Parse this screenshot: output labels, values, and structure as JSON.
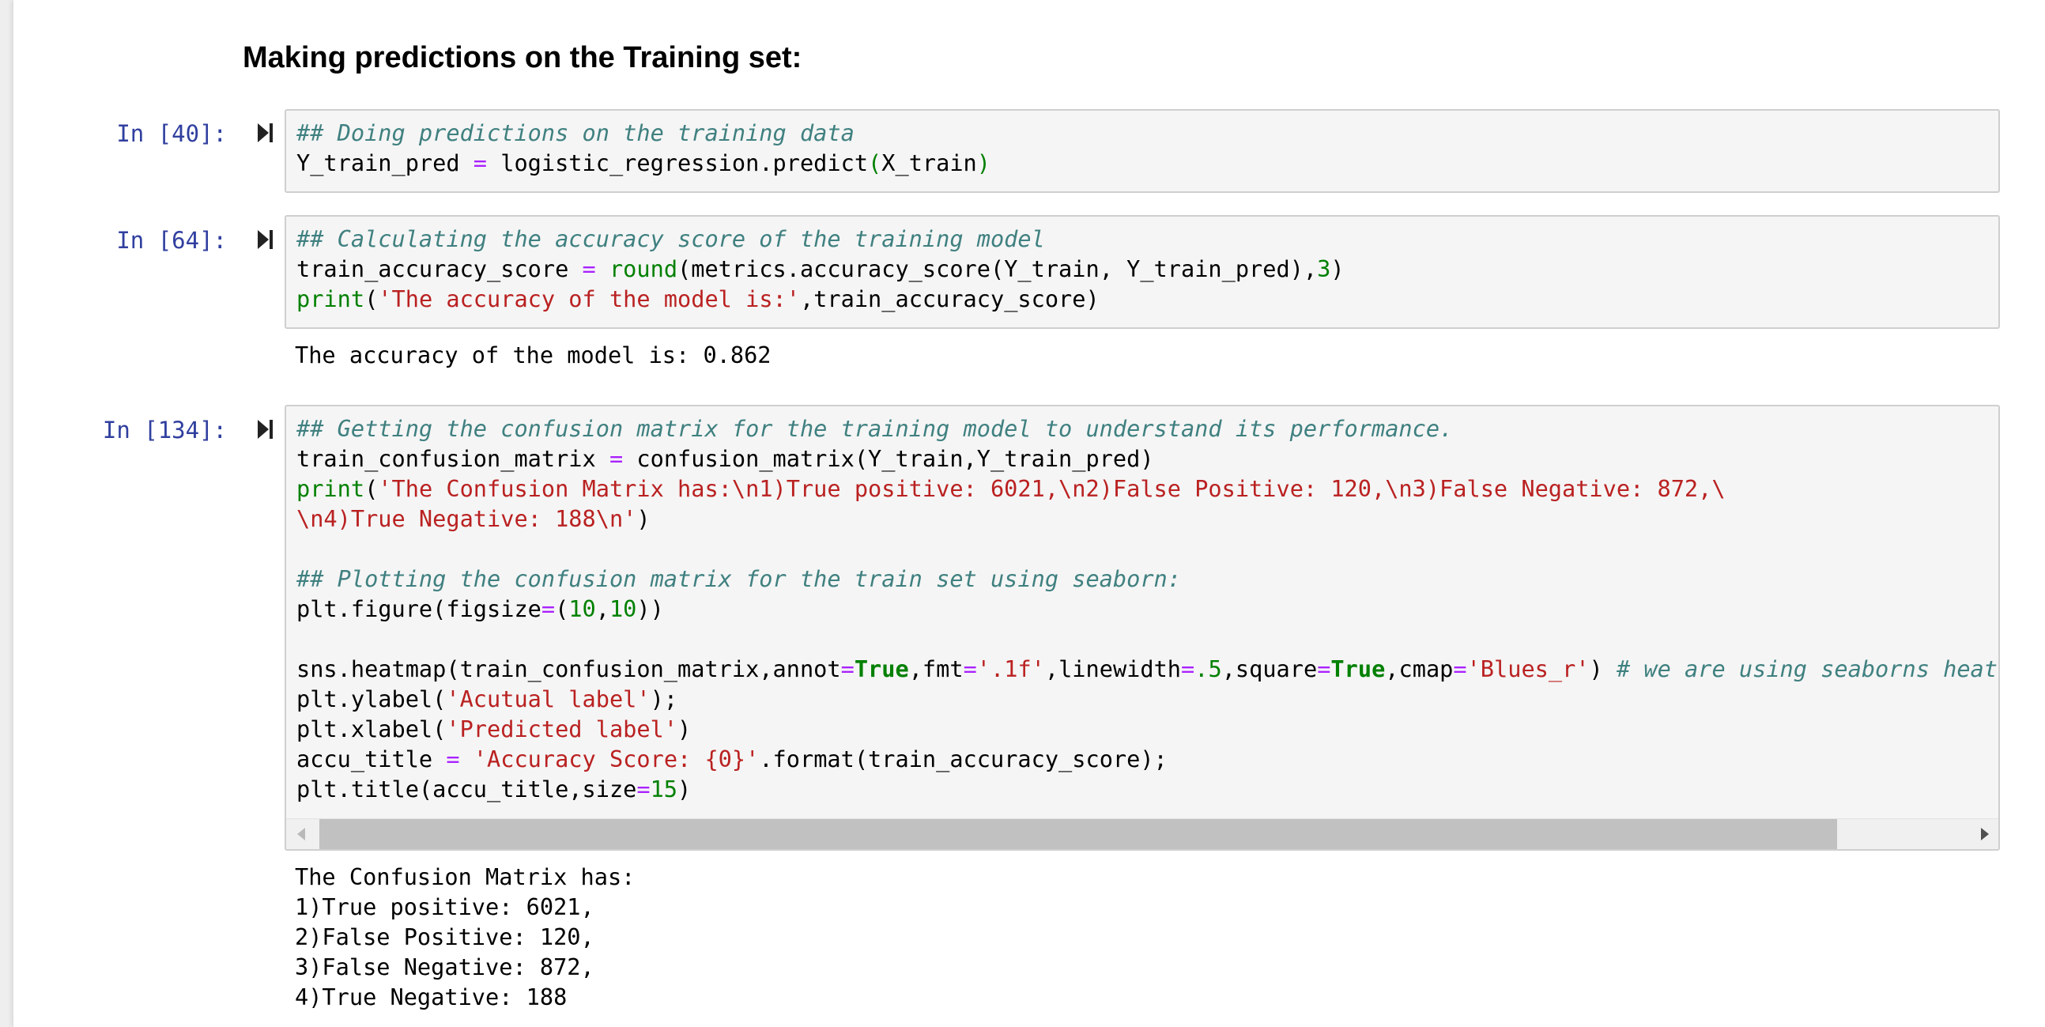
{
  "heading": "Making predictions on the Training set:",
  "icons": {
    "run": "run-cell-icon",
    "scroll_left": "arrow-left-icon",
    "scroll_right": "arrow-right-icon"
  },
  "colors": {
    "prompt": "#303f9f",
    "comment": "#408080",
    "operator": "#aa22ff",
    "number": "#008000",
    "string": "#ba2121",
    "builtin": "#008000",
    "keyword": "#008000"
  },
  "cells": [
    {
      "prompt": "In [40]:",
      "code": [
        [
          {
            "t": "## Doing predictions on the training data",
            "c": "c"
          }
        ],
        [
          {
            "t": "Y_train_pred ",
            "c": "p"
          },
          {
            "t": "=",
            "c": "o"
          },
          {
            "t": " logistic_regression.predict",
            "c": "p"
          },
          {
            "t": "(",
            "c": "pg"
          },
          {
            "t": "X_train",
            "c": "p"
          },
          {
            "t": ")",
            "c": "pg"
          }
        ]
      ],
      "output": null
    },
    {
      "prompt": "In [64]:",
      "code": [
        [
          {
            "t": "## Calculating the accuracy score of the training model",
            "c": "c"
          }
        ],
        [
          {
            "t": "train_accuracy_score ",
            "c": "p"
          },
          {
            "t": "=",
            "c": "o"
          },
          {
            "t": " ",
            "c": "p"
          },
          {
            "t": "round",
            "c": "b"
          },
          {
            "t": "(metrics.accuracy_score(Y_train, Y_train_pred),",
            "c": "p"
          },
          {
            "t": "3",
            "c": "n"
          },
          {
            "t": ")",
            "c": "p"
          }
        ],
        [
          {
            "t": "print",
            "c": "b"
          },
          {
            "t": "(",
            "c": "p"
          },
          {
            "t": "'The accuracy of the model is:'",
            "c": "s"
          },
          {
            "t": ",train_accuracy_score)",
            "c": "p"
          }
        ]
      ],
      "output": [
        "The accuracy of the model is: 0.862"
      ]
    },
    {
      "prompt": "In [134]:",
      "code": [
        [
          {
            "t": "## Getting the confusion matrix for the training model to understand its performance.",
            "c": "c"
          }
        ],
        [
          {
            "t": "train_confusion_matrix ",
            "c": "p"
          },
          {
            "t": "=",
            "c": "o"
          },
          {
            "t": " confusion_matrix(Y_train,Y_train_pred)",
            "c": "p"
          }
        ],
        [
          {
            "t": "print",
            "c": "b"
          },
          {
            "t": "(",
            "c": "p"
          },
          {
            "t": "'The Confusion Matrix has:\\n1)True positive: 6021,\\n2)False Positive: 120,\\n3)False Negative: 872,\\",
            "c": "s"
          }
        ],
        [
          {
            "t": "\\n4)True Negative: 188\\n'",
            "c": "s"
          },
          {
            "t": ")",
            "c": "p"
          }
        ],
        [],
        [
          {
            "t": "## Plotting the confusion matrix for the train set using seaborn:",
            "c": "c"
          }
        ],
        [
          {
            "t": "plt.figure(figsize",
            "c": "p"
          },
          {
            "t": "=",
            "c": "o"
          },
          {
            "t": "(",
            "c": "p"
          },
          {
            "t": "10",
            "c": "n"
          },
          {
            "t": ",",
            "c": "p"
          },
          {
            "t": "10",
            "c": "n"
          },
          {
            "t": "))",
            "c": "p"
          }
        ],
        [],
        [
          {
            "t": "sns.heatmap(train_confusion_matrix,annot",
            "c": "p"
          },
          {
            "t": "=",
            "c": "o"
          },
          {
            "t": "True",
            "c": "k"
          },
          {
            "t": ",fmt",
            "c": "p"
          },
          {
            "t": "=",
            "c": "o"
          },
          {
            "t": "'.1f'",
            "c": "s"
          },
          {
            "t": ",linewidth",
            "c": "p"
          },
          {
            "t": "=",
            "c": "o"
          },
          {
            "t": ".5",
            "c": "n"
          },
          {
            "t": ",square",
            "c": "p"
          },
          {
            "t": "=",
            "c": "o"
          },
          {
            "t": "True",
            "c": "k"
          },
          {
            "t": ",cmap",
            "c": "p"
          },
          {
            "t": "=",
            "c": "o"
          },
          {
            "t": "'Blues_r'",
            "c": "s"
          },
          {
            "t": ") ",
            "c": "p"
          },
          {
            "t": "# we are using seaborns heat",
            "c": "c"
          }
        ],
        [
          {
            "t": "plt.ylabel(",
            "c": "p"
          },
          {
            "t": "'Acutual label'",
            "c": "s"
          },
          {
            "t": ");",
            "c": "p"
          }
        ],
        [
          {
            "t": "plt.xlabel(",
            "c": "p"
          },
          {
            "t": "'Predicted label'",
            "c": "s"
          },
          {
            "t": ")",
            "c": "p"
          }
        ],
        [
          {
            "t": "accu_title ",
            "c": "p"
          },
          {
            "t": "=",
            "c": "o"
          },
          {
            "t": " ",
            "c": "p"
          },
          {
            "t": "'Accuracy Score: {0}'",
            "c": "s"
          },
          {
            "t": ".format(train_accuracy_score);",
            "c": "p"
          }
        ],
        [
          {
            "t": "plt.title(accu_title,size",
            "c": "p"
          },
          {
            "t": "=",
            "c": "o"
          },
          {
            "t": "15",
            "c": "n"
          },
          {
            "t": ")",
            "c": "p"
          }
        ]
      ],
      "output": [
        "The Confusion Matrix has:",
        "1)True positive: 6021,",
        "2)False Positive: 120,",
        "3)False Negative: 872,",
        "4)True Negative: 188"
      ]
    }
  ]
}
